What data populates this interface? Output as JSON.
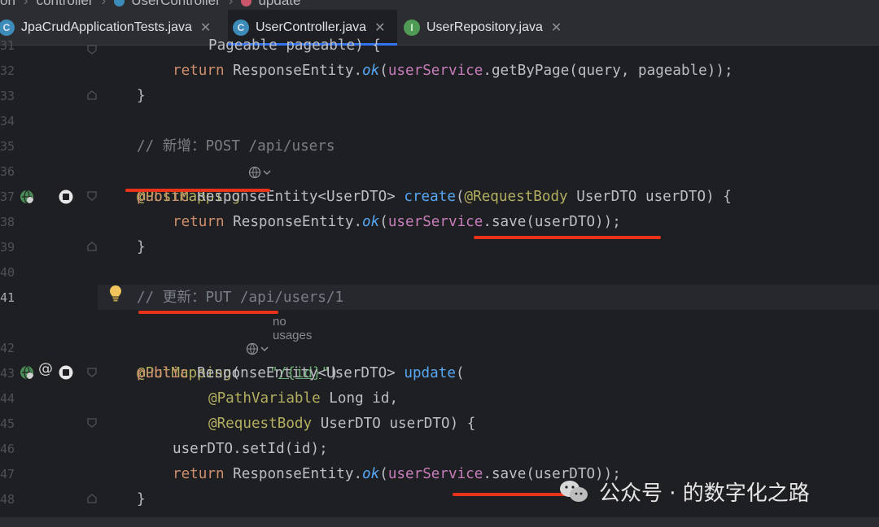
{
  "breadcrumb": {
    "items": [
      "on",
      "controller",
      "UserController",
      "update"
    ]
  },
  "tabs": [
    {
      "label": "JpaCrudApplicationTests.java",
      "icon": "class-icon",
      "active": false
    },
    {
      "label": "UserController.java",
      "icon": "class-icon",
      "active": true
    },
    {
      "label": "UserRepository.java",
      "icon": "interface-icon",
      "active": false
    }
  ],
  "line_numbers": [
    "31",
    "32",
    "33",
    "34",
    "35",
    "36",
    "37",
    "38",
    "39",
    "40",
    "41",
    "42",
    "43",
    "44",
    "45",
    "46",
    "47",
    "48"
  ],
  "code": {
    "l31": {
      "text": "Pageable pageable) {"
    },
    "l32": {
      "kw": "return",
      "cls": "ResponseEntity.",
      "method": "ok",
      "p1": "(",
      "field": "userService",
      "rest": ".getByPage(query, pageable));"
    },
    "l33": {
      "text": "}"
    },
    "l35": {
      "comment": "// 新增：POST /api/users"
    },
    "l36": {
      "annotation": "@PostMapping"
    },
    "l37": {
      "kw": "public",
      "type": " ResponseEntity<UserDTO> ",
      "name": "create",
      "p1": "(",
      "ann": "@RequestBody",
      "rest": " UserDTO userDTO) {"
    },
    "l38": {
      "kw": "return",
      "cls": "ResponseEntity.",
      "method": "ok",
      "p1": "(",
      "field": "userService",
      "rest": ".save(userDTO));"
    },
    "l39": {
      "text": "}"
    },
    "l41": {
      "comment": "// 更新：PUT /api/users/1"
    },
    "usages": "no usages",
    "l42": {
      "annotation": "@PutMapping",
      "p1": "(",
      "q1": "\"",
      "path": "/{id}",
      "q2": "\"",
      "p2": ")"
    },
    "l43": {
      "kw": "public",
      "type": " ResponseEntity<UserDTO> ",
      "name": "update",
      "p1": "("
    },
    "l44": {
      "ann": "@PathVariable",
      "rest": " Long id,"
    },
    "l45": {
      "ann": "@RequestBody",
      "rest": " UserDTO userDTO) {"
    },
    "l46": {
      "text": "userDTO.setId(id);"
    },
    "l47": {
      "kw": "return",
      "cls": "ResponseEntity.",
      "method": "ok",
      "p1": "(",
      "field": "userService",
      "rest": ".save(userDTO));"
    },
    "l48": {
      "text": "}"
    }
  },
  "watermark": {
    "text": "公众号 · 的数字化之路"
  },
  "colors": {
    "keyword": "#cf8e6d",
    "annotation": "#b3ae60",
    "field": "#c77dbb",
    "function": "#56a8f5",
    "comment": "#7a7e85",
    "highlight": "#e8321a"
  }
}
